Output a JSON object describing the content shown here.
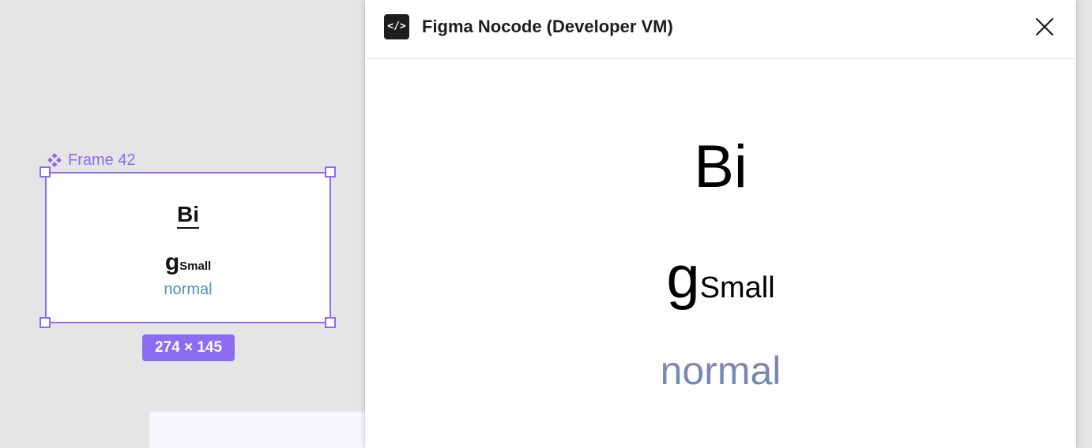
{
  "canvas": {
    "frame_name": "Frame 42",
    "frame_text": {
      "line1": "Bi",
      "line2_big": "g",
      "line2_small": "Small",
      "line3": "normal"
    },
    "dimensions": "274 × 145"
  },
  "plugin": {
    "icon_label": "</>",
    "title": "Figma Nocode (Developer VM)",
    "preview": {
      "line1": "Bi",
      "line2_big": "g",
      "line2_small": "Small",
      "line3": "normal"
    }
  },
  "colors": {
    "selection": "#8c6cf2",
    "canvas_bg": "#e5e5e5",
    "normal_text": "#4d8fbd"
  },
  "icons": {
    "component": "component-icon",
    "plugin": "code-icon",
    "close": "close-icon"
  }
}
